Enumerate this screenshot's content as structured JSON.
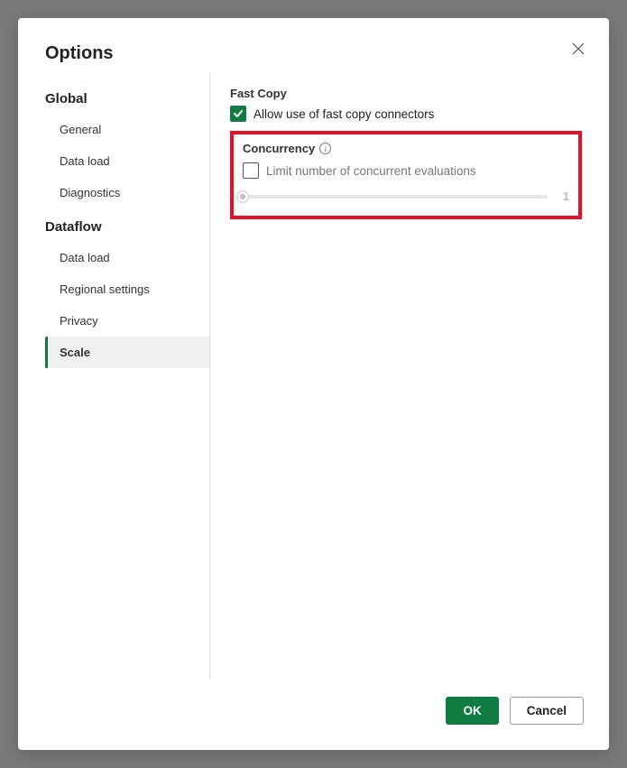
{
  "dialog": {
    "title": "Options"
  },
  "sidebar": {
    "sections": [
      {
        "title": "Global",
        "items": [
          {
            "label": "General"
          },
          {
            "label": "Data load"
          },
          {
            "label": "Diagnostics"
          }
        ]
      },
      {
        "title": "Dataflow",
        "items": [
          {
            "label": "Data load"
          },
          {
            "label": "Regional settings"
          },
          {
            "label": "Privacy"
          },
          {
            "label": "Scale",
            "active": true
          }
        ]
      }
    ]
  },
  "content": {
    "fastCopy": {
      "title": "Fast Copy",
      "allowLabel": "Allow use of fast copy connectors",
      "allowChecked": true
    },
    "concurrency": {
      "title": "Concurrency",
      "limitLabel": "Limit number of concurrent evaluations",
      "limitChecked": false,
      "sliderValue": "1"
    }
  },
  "footer": {
    "ok": "OK",
    "cancel": "Cancel"
  }
}
